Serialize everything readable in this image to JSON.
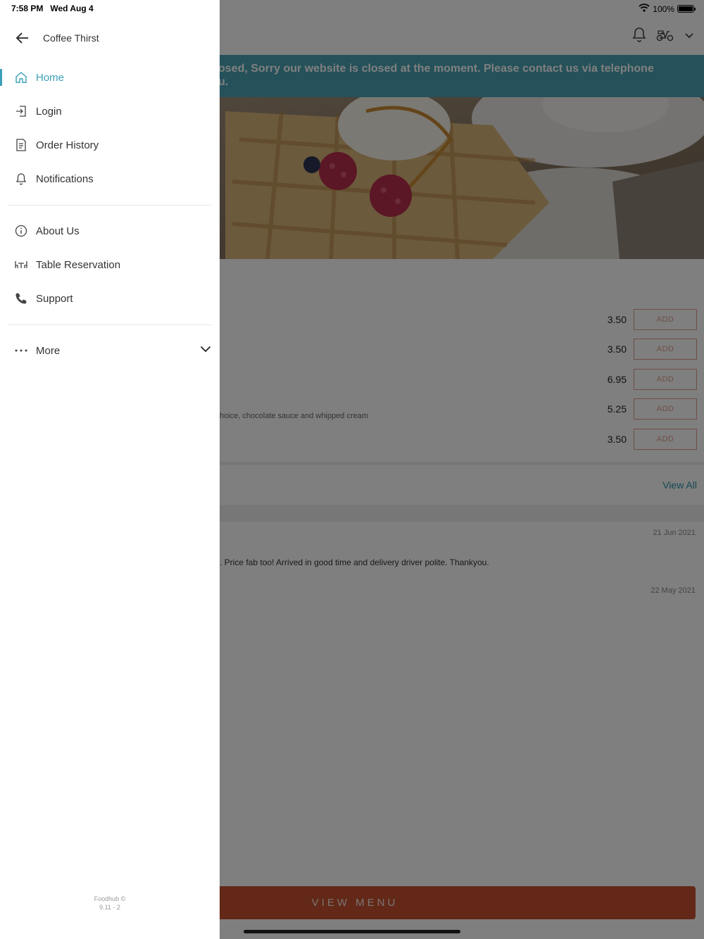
{
  "status_bar": {
    "time": "7:58 PM",
    "date": "Wed Aug 4",
    "battery": "100%",
    "battery_level": 1.0
  },
  "drawer": {
    "title": "Coffee Thirst",
    "items_main": [
      {
        "label": "Home",
        "icon": "home-icon",
        "active": true
      },
      {
        "label": "Login",
        "icon": "login-icon"
      },
      {
        "label": "Order History",
        "icon": "order-history-icon"
      },
      {
        "label": "Notifications",
        "icon": "bell-icon"
      }
    ],
    "items_secondary": [
      {
        "label": "About Us",
        "icon": "info-icon"
      },
      {
        "label": "Table Reservation",
        "icon": "table-icon"
      },
      {
        "label": "Support",
        "icon": "phone-icon"
      }
    ],
    "more": {
      "label": "More",
      "icon": "more-dots-icon"
    },
    "footer": {
      "line1": "Foodhub ©",
      "line2": "9.11 - 2"
    }
  },
  "app": {
    "banner": {
      "line1": "osed, Sorry our website is closed at the moment. Please contact us via telephone",
      "line2": "u."
    },
    "menu_items": [
      {
        "price": "3.50",
        "button": "ADD"
      },
      {
        "price": "3.50",
        "button": "ADD"
      },
      {
        "price": "6.95",
        "button": "ADD"
      },
      {
        "price": "5.25",
        "button": "ADD"
      },
      {
        "price": "3.50",
        "button": "ADD"
      }
    ],
    "item_description": "hoice, chocolate sauce and whipped cream",
    "view_all": "View All",
    "reviews": [
      {
        "date": "21 Jun 2021",
        "text": ". Price fab too! Arrived in good time and delivery driver polite. Thankyou."
      },
      {
        "date": "22 May 2021",
        "text": ""
      }
    ],
    "view_menu": "VIEW MENU"
  },
  "colors": {
    "accent": "#3aa0b8",
    "banner": "#4ba3b5",
    "cta": "#c6512f",
    "add_border": "#e09a8a"
  }
}
